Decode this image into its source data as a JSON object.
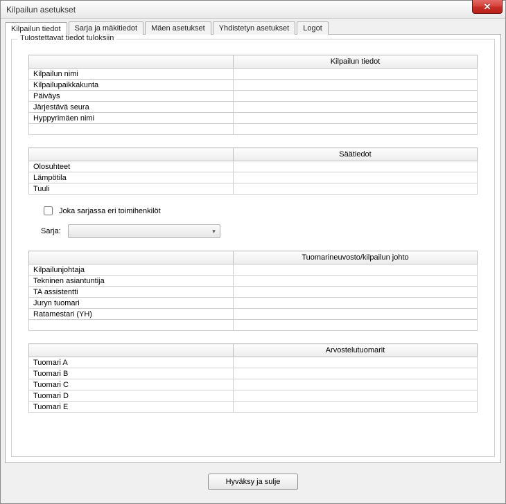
{
  "window": {
    "title": "Kilpailun asetukset",
    "close_label": "✕"
  },
  "tabs": {
    "t0": "Kilpailun tiedot",
    "t1": "Sarja ja mäkitiedot",
    "t2": "Mäen asetukset",
    "t3": "Yhdistetyn asetukset",
    "t4": "Logot"
  },
  "group": {
    "label": "Tulostettavat tiedot tuloksiin"
  },
  "comp_info": {
    "header_left": "",
    "header_right": "Kilpailun tiedot",
    "rows": {
      "r0": "Kilpailun nimi",
      "r1": "Kilpailupaikkakunta",
      "r2": "Päiväys",
      "r3": "Järjestävä seura",
      "r4": "Hyppyrimäen nimi"
    },
    "vals": {
      "r0": "",
      "r1": "",
      "r2": "",
      "r3": "",
      "r4": "",
      "r5": ""
    }
  },
  "weather": {
    "header_left": "",
    "header_right": "Säätiedot",
    "rows": {
      "r0": "Olosuhteet",
      "r1": "Lämpötila",
      "r2": "Tuuli"
    },
    "vals": {
      "r0": "",
      "r1": "",
      "r2": ""
    }
  },
  "controls": {
    "checkbox_label": "Joka sarjassa eri toimihenkilöt",
    "series_label": "Sarja:",
    "series_selected": ""
  },
  "jury": {
    "header_left": "",
    "header_right": "Tuomarineuvosto/kilpailun johto",
    "rows": {
      "r0": "Kilpailunjohtaja",
      "r1": "Tekninen asiantuntija",
      "r2": "TA assistentti",
      "r3": "Juryn tuomari",
      "r4": "Ratamestari (YH)"
    },
    "vals": {
      "r0": "",
      "r1": "",
      "r2": "",
      "r3": "",
      "r4": "",
      "r5": ""
    }
  },
  "judges": {
    "header_left": "",
    "header_right": "Arvostelutuomarit",
    "rows": {
      "r0": "Tuomari A",
      "r1": "Tuomari B",
      "r2": "Tuomari C",
      "r3": "Tuomari D",
      "r4": "Tuomari E"
    },
    "vals": {
      "r0": "",
      "r1": "",
      "r2": "",
      "r3": "",
      "r4": ""
    }
  },
  "footer": {
    "ok_label": "Hyväksy ja sulje"
  }
}
